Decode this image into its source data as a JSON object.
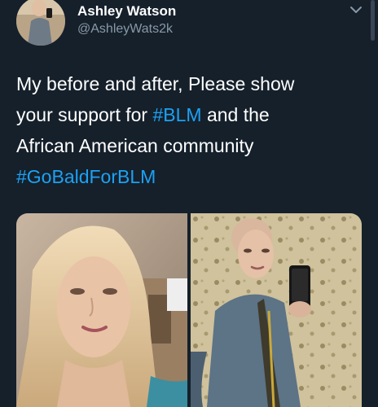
{
  "author": {
    "display_name": "Ashley Watson",
    "handle": "@AshleyWats2k",
    "avatar_icon": "profile-photo"
  },
  "menu": {
    "icon": "chevron-down-icon"
  },
  "tweet": {
    "line1": "My before and after, Please show",
    "line2_prefix": "your support for ",
    "hashtag1": "#BLM",
    "line2_suffix": " and the",
    "line3": "African American community",
    "hashtag2": "#GoBaldForBLM"
  },
  "media": {
    "left_label": "before-photo",
    "right_label": "after-photo"
  },
  "colors": {
    "background": "#15202b",
    "text": "#ffffff",
    "secondary_text": "#8899a6",
    "link": "#1da1f2"
  }
}
